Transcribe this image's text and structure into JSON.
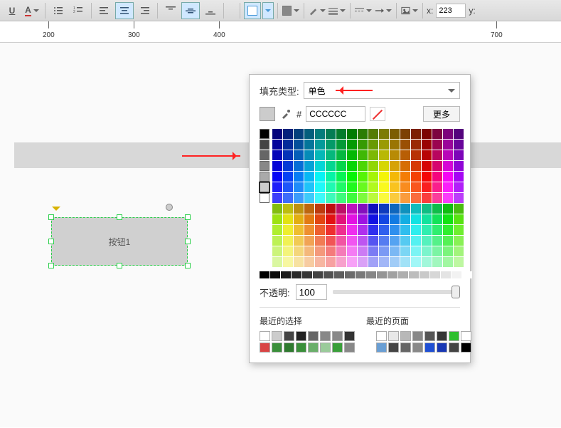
{
  "toolbar": {
    "x_label": "x:",
    "x_value": "223",
    "y_label": "y:"
  },
  "ruler": {
    "ticks": [
      "200",
      "300",
      "400",
      "700"
    ]
  },
  "widget": {
    "label": "按钮1"
  },
  "fill_panel": {
    "type_label": "填充类型:",
    "type_value": "单色",
    "hash": "#",
    "hex_value": "CCCCCC",
    "more_label": "更多",
    "grays": [
      "#000000",
      "#444444",
      "#666666",
      "#888888",
      "#aaaaaa",
      "#cccccc",
      "#ffffff"
    ],
    "opacity_label": "不透明:",
    "opacity_value": "100",
    "recent_sel_label": "最近的选择",
    "recent_page_label": "最近的页面",
    "recent_sel": [
      "#ffffff",
      "#cccccc",
      "#444444",
      "#222222",
      "#666666",
      "#888888",
      "#888888",
      "#333333",
      "#d94444",
      "#3a8f3a",
      "#2e7a2e",
      "#3a8f3a",
      "#6aaf6a",
      "#9acb9a",
      "#3a9f3a",
      "#888888"
    ],
    "recent_page": [
      "#ffffff",
      "#e8e8e8",
      "#b8b8b8",
      "#888888",
      "#555555",
      "#353535",
      "#2fbf2f",
      "#ffffff",
      "#6a9fd4",
      "#444444",
      "#666666",
      "#888888",
      "#1f4fd4",
      "#1837b4",
      "#444444",
      "#000000"
    ]
  }
}
